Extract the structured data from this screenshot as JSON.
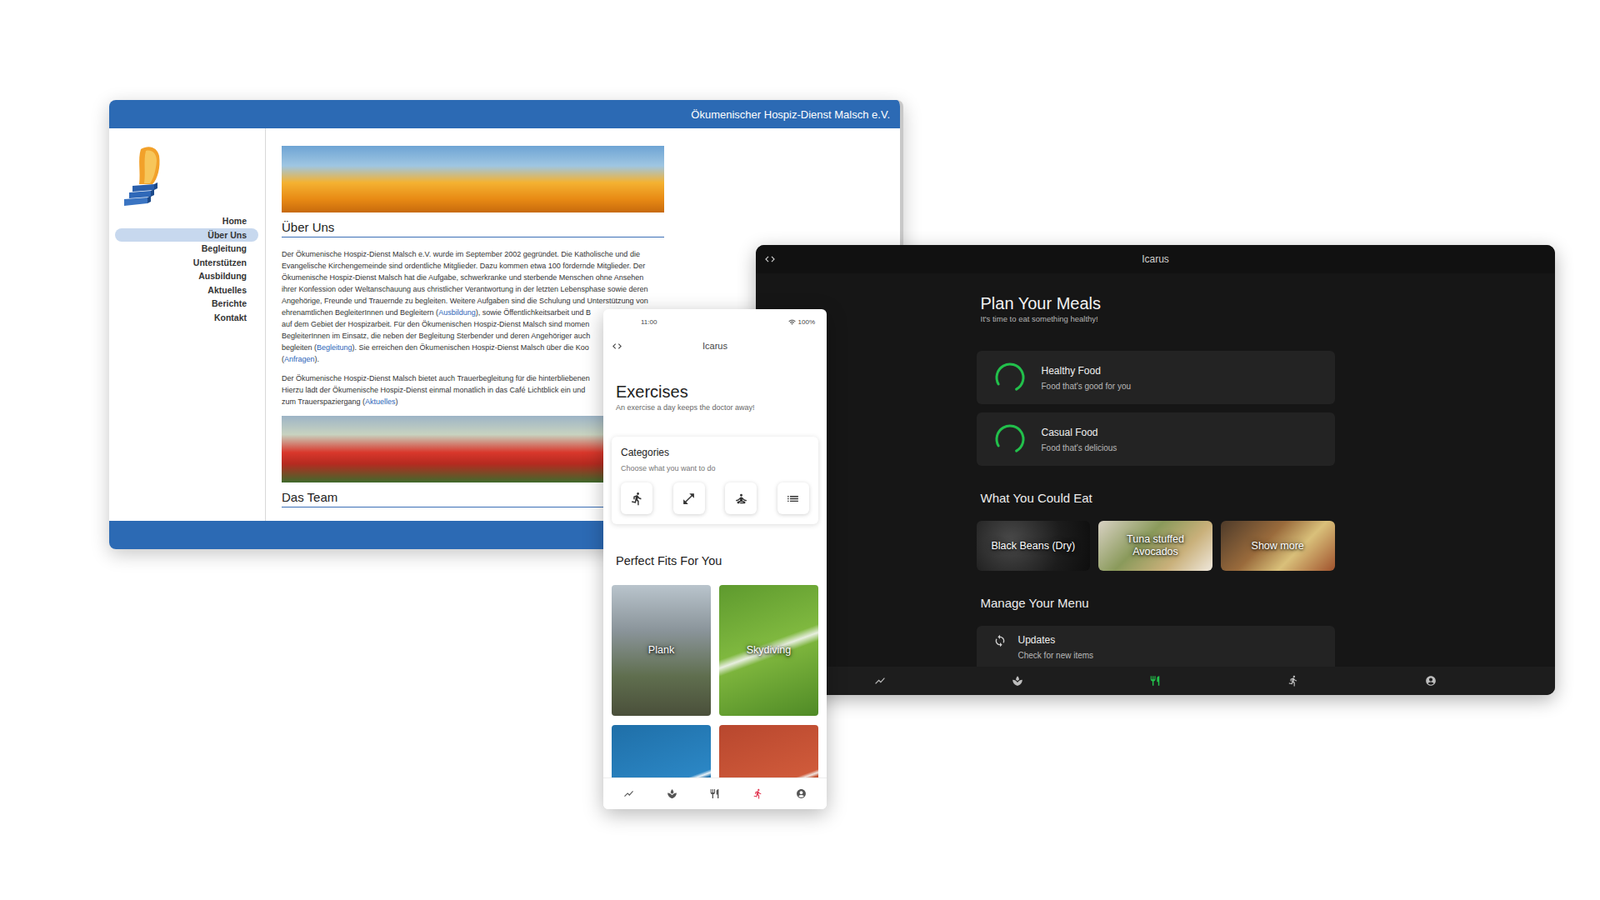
{
  "website": {
    "title": "Ökumenischer Hospiz-Dienst Malsch e.V.",
    "nav": [
      {
        "label": "Home",
        "selected": false
      },
      {
        "label": "Über Uns",
        "selected": true
      },
      {
        "label": "Begleitung",
        "selected": false
      },
      {
        "label": "Unterstützen",
        "selected": false
      },
      {
        "label": "Ausbildung",
        "selected": false
      },
      {
        "label": "Aktuelles",
        "selected": false
      },
      {
        "label": "Berichte",
        "selected": false
      },
      {
        "label": "Kontakt",
        "selected": false
      }
    ],
    "about": {
      "heading": "Über Uns",
      "paragraphs": [
        [
          [
            {
              "text": "Der Ökumenische Hospiz-Dienst Malsch e.V. wurde im September 2002 gegründet. Die Katholische und die",
              "link": false
            }
          ],
          [
            {
              "text": "Evangelische Kirchengemeinde sind ordentliche Mitglieder. Dazu kommen etwa 100 fördernde Mitglieder. Der",
              "link": false
            }
          ],
          [
            {
              "text": "Ökumenische Hospiz-Dienst Malsch hat die Aufgabe, schwerkranke und sterbende Menschen ohne Ansehen",
              "link": false
            }
          ],
          [
            {
              "text": "ihrer Konfession oder Weltanschauung aus christlicher Verantwortung in der letzten Lebensphase sowie deren",
              "link": false
            }
          ],
          [
            {
              "text": "Angehörige, Freunde und Trauernde zu begleiten. Weitere Aufgaben sind die Schulung und Unterstützung von",
              "link": false
            }
          ],
          [
            {
              "text": "ehrenamtlichen BegleiterInnen und Begleitern (",
              "link": false
            },
            {
              "text": "Ausbildung",
              "link": true
            },
            {
              "text": "), sowie Öffentlichkeitsarbeit und B",
              "link": false
            }
          ],
          [
            {
              "text": "auf dem Gebiet der Hospizarbeit. Für den Ökumenischen Hospiz-Dienst Malsch sind momen",
              "link": false
            }
          ],
          [
            {
              "text": "BegleiterInnen im Einsatz, die neben der Begleitung Sterbender und deren Angehöriger auch",
              "link": false
            }
          ],
          [
            {
              "text": "begleiten (",
              "link": false
            },
            {
              "text": "Begleitung",
              "link": true
            },
            {
              "text": "). Sie erreichen den Ökumenischen Hospiz-Dienst Malsch über die Koo",
              "link": false
            }
          ],
          [
            {
              "text": "(",
              "link": false
            },
            {
              "text": "Anfragen",
              "link": true
            },
            {
              "text": ").",
              "link": false
            }
          ]
        ],
        [
          [
            {
              "text": "Der Ökumenische Hospiz-Dienst Malsch bietet auch Trauerbegleitung für die hinterbliebenen",
              "link": false
            }
          ],
          [
            {
              "text": "Hierzu lädt der Ökumenische Hospiz-Dienst einmal monatlich in das Café Lichtblick ein und",
              "link": false
            }
          ],
          [
            {
              "text": "zum Trauerspaziergang (",
              "link": false
            },
            {
              "text": "Aktuelles",
              "link": true
            },
            {
              "text": ")",
              "link": false
            }
          ]
        ]
      ]
    },
    "team": {
      "heading": "Das Team"
    }
  },
  "meals_app": {
    "title": "Icarus",
    "heading": "Plan Your Meals",
    "subtitle": "It's time to eat something healthy!",
    "plans": [
      {
        "title": "Healthy Food",
        "subtitle": "Food that's good for you",
        "level": 0.75
      },
      {
        "title": "Casual Food",
        "subtitle": "Food that's delicious",
        "level": 0.75
      }
    ],
    "suggestions_heading": "What You Could Eat",
    "suggestions": [
      {
        "label": "Black Beans (Dry)"
      },
      {
        "label": "Tuna stuffed Avocados"
      },
      {
        "label": "Show more"
      }
    ],
    "menu_heading": "Manage Your Menu",
    "menu_items": [
      {
        "title": "Updates",
        "subtitle": "Check for new items"
      }
    ],
    "nav": [
      {
        "selected": false
      },
      {
        "selected": false
      },
      {
        "selected": true
      },
      {
        "selected": false
      },
      {
        "selected": false
      }
    ]
  },
  "exercises_app": {
    "status": {
      "time": "11:00",
      "battery": "100%"
    },
    "title": "Icarus",
    "heading": "Exercises",
    "subtitle": "An exercise a day keeps the doctor away!",
    "categories": {
      "title": "Categories",
      "subtitle": "Choose what you want to do"
    },
    "fits_heading": "Perfect Fits For You",
    "fits": [
      {
        "label": "Plank"
      },
      {
        "label": "Skydiving"
      }
    ],
    "nav": [
      {
        "selected": false
      },
      {
        "selected": false
      },
      {
        "selected": false
      },
      {
        "selected": true
      },
      {
        "selected": false
      }
    ]
  }
}
